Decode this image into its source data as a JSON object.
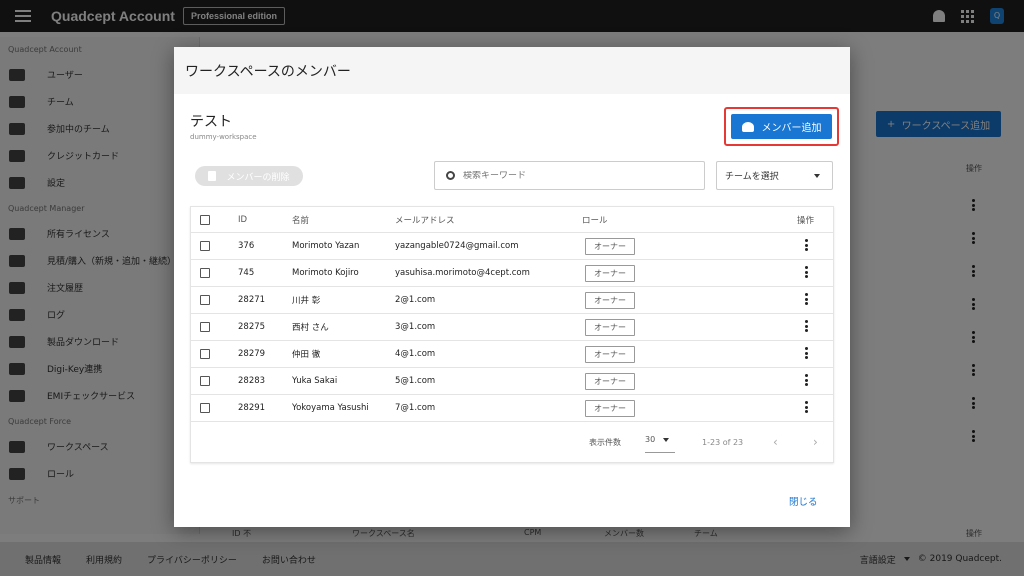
{
  "app": {
    "brand": "Quadcept Account",
    "edition": "Professional edition",
    "user_initial": "Q"
  },
  "sidebar": {
    "sections": [
      {
        "title": "Quadcept Account",
        "items": [
          "ユーザー",
          "チーム",
          "参加中のチーム",
          "クレジットカード",
          "設定"
        ]
      },
      {
        "title": "Quadcept Manager",
        "items": [
          "所有ライセンス",
          "見積/購入（新規・追加・継続）",
          "注文履歴",
          "ログ",
          "製品ダウンロード",
          "Digi-Key連携",
          "EMIチェックサービス"
        ]
      },
      {
        "title": "Quadcept Force",
        "items": [
          "ワークスペース",
          "ロール"
        ]
      },
      {
        "title": "サポート",
        "items": []
      }
    ]
  },
  "background": {
    "add_workspace": "ワークスペース追加",
    "op_header": "操作",
    "col_bottom": [
      "ID 不",
      "ワークスペース名",
      "CPM",
      "メンバー数",
      "チーム",
      "操作"
    ]
  },
  "footer": {
    "links": [
      "製品情報",
      "利用規約",
      "プライバシーポリシー",
      "お問い合わせ"
    ],
    "lang": "言語設定",
    "copyright": "© 2019 Quadcept."
  },
  "modal": {
    "title": "ワークスペースのメンバー",
    "workspace_name": "テスト",
    "workspace_id": "dummy-workspace",
    "add_member": "メンバー追加",
    "delete_member": "メンバーの削除",
    "search_placeholder": "検索キーワード",
    "team_select": "チームを選択",
    "headers": {
      "id": "ID",
      "name": "名前",
      "email": "メールアドレス",
      "role": "ロール",
      "ops": "操作"
    },
    "rows": [
      {
        "id": "376",
        "name": "Morimoto Yazan",
        "email": "yazangable0724@gmail.com",
        "role": "オーナー"
      },
      {
        "id": "745",
        "name": "Morimoto Kojiro",
        "email": "yasuhisa.morimoto@4cept.com",
        "role": "オーナー"
      },
      {
        "id": "28271",
        "name": "川井 彰",
        "email": "2@1.com",
        "role": "オーナー"
      },
      {
        "id": "28275",
        "name": "西村 さん",
        "email": "3@1.com",
        "role": "オーナー"
      },
      {
        "id": "28279",
        "name": "仲田 徹",
        "email": "4@1.com",
        "role": "オーナー"
      },
      {
        "id": "28283",
        "name": "Yuka Sakai",
        "email": "5@1.com",
        "role": "オーナー"
      },
      {
        "id": "28291",
        "name": "Yokoyama Yasushi",
        "email": "7@1.com",
        "role": "オーナー"
      }
    ],
    "pager": {
      "label": "表示件数",
      "per_page": "30",
      "range": "1-23 of 23"
    },
    "close": "閉じる"
  },
  "colors": {
    "primary": "#1976d2",
    "highlight": "#e53935",
    "topbar": "#212121"
  }
}
